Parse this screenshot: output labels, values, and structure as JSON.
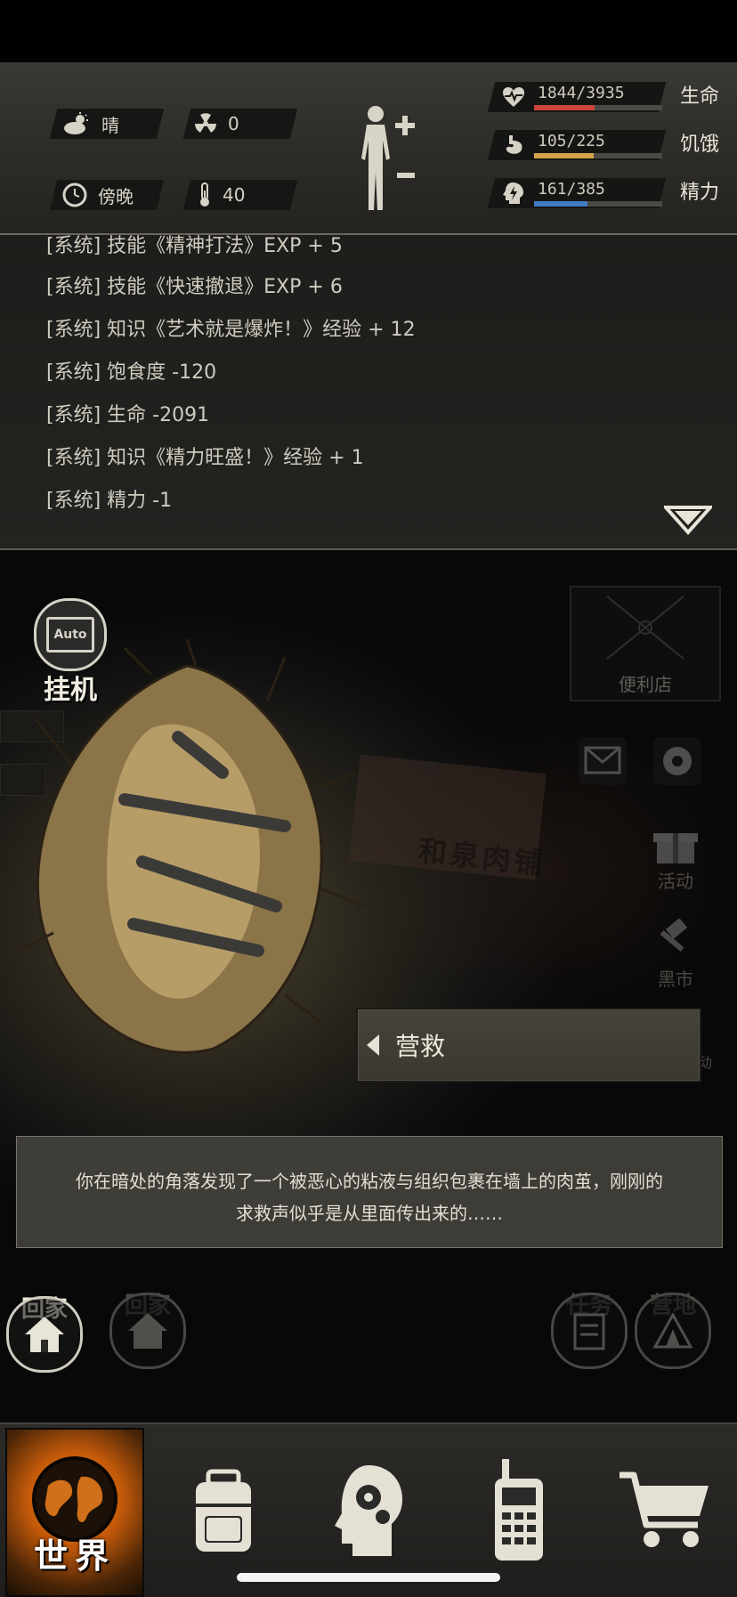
{
  "hud": {
    "weather": "晴",
    "radiation": "0",
    "time_of_day": "傍晚",
    "temperature": "40",
    "stats": [
      {
        "name": "生命",
        "value": "1844/3935",
        "fraction": 0.469,
        "color": "#c8453a",
        "icon": "heart-pulse-icon"
      },
      {
        "name": "饥饿",
        "value": "105/225",
        "fraction": 0.467,
        "color": "#d4a24a",
        "icon": "stomach-icon"
      },
      {
        "name": "精力",
        "value": "161/385",
        "fraction": 0.418,
        "color": "#3f7cc2",
        "icon": "energy-head-icon"
      }
    ]
  },
  "log": {
    "lines": [
      "[系统] 技能《精神打法》EXP + 5",
      "[系统] 技能《快速撤退》EXP + 6",
      "[系统] 知识《艺术就是爆炸！》经验 + 12",
      "[系统] 饱食度 -120",
      "[系统] 生命 -2091",
      "[系统] 知识《精力旺盛！》经验 + 1",
      "[系统] 精力 -1"
    ]
  },
  "scene": {
    "auto_label": "Auto",
    "idle_label": "挂机",
    "store_label": "便利店",
    "activity_label": "活动",
    "black_market_label": "黑市",
    "spring_event_label": "春节活动",
    "shop_sign": "和泉肉铺",
    "action_label": "营救",
    "description_line1": "你在暗处的角落发现了一个被恶心的粘液与组织包裹在墙上的肉茧，刚刚的",
    "description_line2": "求救声似乎是从里面传出来的……",
    "home_label": "回家",
    "home_label_faded": "回家",
    "task_label": "任务",
    "camp_label": "营地"
  },
  "nav": {
    "world_label": "世界"
  }
}
